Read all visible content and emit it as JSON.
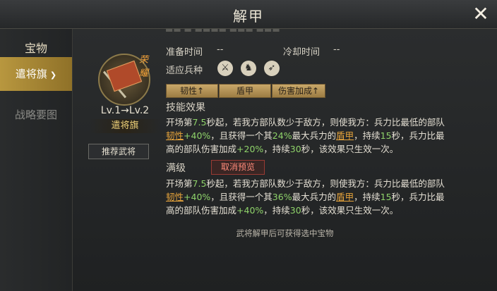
{
  "header": {
    "title": "解甲"
  },
  "sidebar": {
    "items": [
      {
        "label": "宝物"
      },
      {
        "label": "遣将旗"
      },
      {
        "label": "战略要图"
      }
    ]
  },
  "item": {
    "level": "Lv.1→Lv.2",
    "name": "遣将旗",
    "badge": "荣耀",
    "recommend_label": "推荐武将"
  },
  "stats": {
    "prep_label": "准备时间",
    "prep_value": "--",
    "cooldown_label": "冷却时间",
    "cooldown_value": "--",
    "units_label": "适应兵种",
    "units": [
      "crossed-swords-icon",
      "horse-icon",
      "bow-icon"
    ]
  },
  "tags": [
    "韧性↑",
    "盾甲",
    "伤害加成↑"
  ],
  "skill": {
    "title": "技能效果",
    "line1": [
      "开场第",
      "7.5",
      "秒起，若我方部队数少于敌方，则使我方：兵力比最低的部队"
    ],
    "line2": [
      "韧性",
      "+40%",
      "，且获得一个其",
      "24%",
      "最大兵力的",
      "盾甲",
      "，持续",
      "15",
      "秒，兵力比最"
    ],
    "line3": [
      "高的部队伤害加成",
      "+20%",
      "，持续",
      "30",
      "秒，该效果只生效一次。"
    ]
  },
  "max": {
    "title": "满级",
    "cancel_label": "取消预览",
    "line1": [
      "开场第",
      "7.5",
      "秒起，若我方部队数少于敌方，则使我方：兵力比最低的部队"
    ],
    "line2": [
      "韧性",
      "+40%",
      "，且获得一个其",
      "36%",
      "最大兵力的",
      "盾甲",
      "，持续",
      "15",
      "秒，兵力比最"
    ],
    "line3": [
      "高的部队伤害加成",
      "+40%",
      "，持续",
      "30",
      "秒，该效果只生效一次。"
    ]
  },
  "footer_note": "武将解甲后可获得选中宝物",
  "colors": {
    "accent_gold": "#b8973f",
    "number_green": "#8fd36a",
    "buff_orange": "#e7a43b",
    "cancel_red": "#ff8a7a"
  }
}
